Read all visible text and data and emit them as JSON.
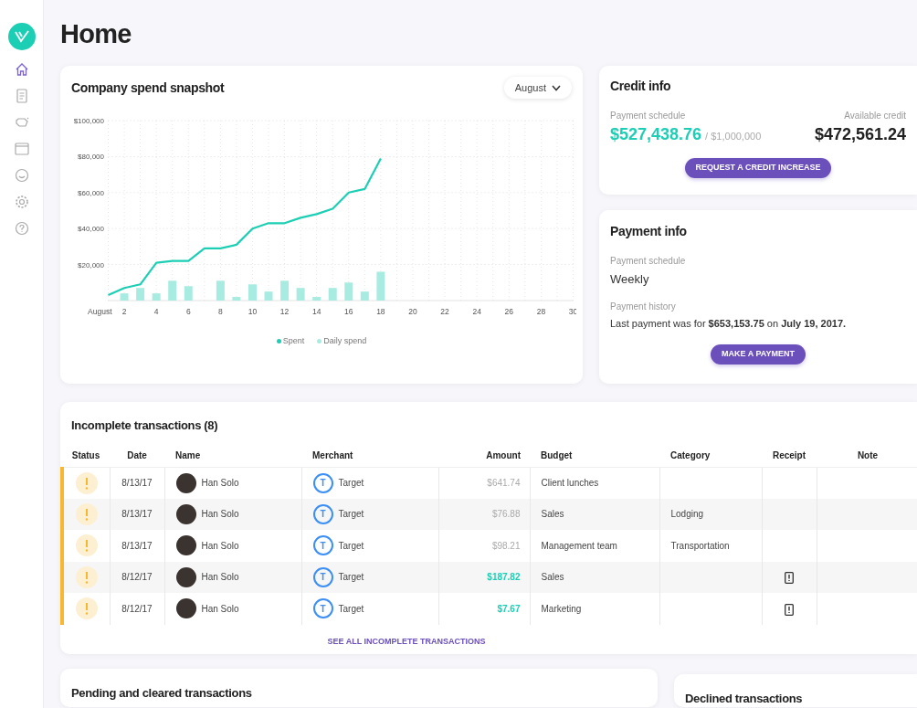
{
  "sidebar": {
    "items": [
      {
        "kind": "home",
        "selected": true
      },
      {
        "kind": "document",
        "selected": false
      },
      {
        "kind": "piggy",
        "selected": false
      },
      {
        "kind": "window",
        "selected": false
      },
      {
        "kind": "smiley",
        "selected": false
      },
      {
        "kind": "gear",
        "selected": false
      },
      {
        "kind": "help",
        "selected": false
      }
    ]
  },
  "page_title": "Home",
  "spend_snapshot": {
    "title": "Company spend snapshot",
    "month_dropdown": "August",
    "chart_data": {
      "type": "line",
      "x": [
        1,
        2,
        3,
        4,
        5,
        6,
        7,
        8,
        9,
        10,
        11,
        12,
        13,
        14,
        15,
        16,
        17,
        18
      ],
      "xlim": [
        1,
        30
      ],
      "ylim": [
        0,
        100000
      ],
      "xlabel": "August",
      "grid": true,
      "xticks": [
        2,
        4,
        6,
        8,
        10,
        12,
        14,
        16,
        18,
        20,
        22,
        24,
        26,
        28,
        30
      ],
      "yticks": [
        {
          "value": 20000,
          "label": "$20,000"
        },
        {
          "value": 40000,
          "label": "$40,000"
        },
        {
          "value": 60000,
          "label": "$60,000"
        },
        {
          "value": 80000,
          "label": "$80,000"
        },
        {
          "value": 100000,
          "label": "$100,000"
        }
      ],
      "series": [
        {
          "name": "Spent",
          "color": "#1ccfb4",
          "values": [
            3000,
            7000,
            9000,
            21000,
            22000,
            22000,
            29000,
            29000,
            31000,
            40000,
            43000,
            43000,
            46000,
            48000,
            51000,
            60000,
            62000,
            79000
          ]
        },
        {
          "name": "Daily spend",
          "type": "bar",
          "color": "#a8ece1",
          "values": [
            null,
            4000,
            7000,
            4000,
            11000,
            8000,
            null,
            11000,
            2000,
            9000,
            5000,
            11000,
            7000,
            2000,
            7000,
            10000,
            5000,
            16000
          ]
        }
      ]
    }
  },
  "credit_info": {
    "title": "Credit info",
    "schedule_label": "Payment schedule",
    "spent": "$527,438.76",
    "limit": "/ $1,000,000",
    "available_label": "Available credit",
    "available": "$472,561.24",
    "button": "REQUEST A CREDIT INCREASE"
  },
  "payment_info": {
    "title": "Payment info",
    "schedule_label": "Payment schedule",
    "schedule": "Weekly",
    "history_label": "Payment history",
    "history": "Last payment was for **$653,153.75** on **July 19, 2017.**",
    "button": "MAKE A PAYMENT"
  },
  "incomplete_transactions": {
    "title": "Incomplete transactions (8)",
    "columns": [
      "Status",
      "Date",
      "Name",
      "Merchant",
      "Amount",
      "Budget",
      "Category",
      "Receipt",
      "Note"
    ],
    "rows": [
      {
        "date": "8/13/17",
        "name": "Han Solo",
        "merchant_initial": "T",
        "merchant": "Target",
        "amount": "$641.74",
        "receipt_attached": false,
        "budget": "Client lunches",
        "category": ""
      },
      {
        "date": "8/13/17",
        "name": "Han Solo",
        "merchant_initial": "T",
        "merchant": "Target",
        "amount": "$76.88",
        "receipt_attached": false,
        "budget": "Sales",
        "category": "Lodging"
      },
      {
        "date": "8/13/17",
        "name": "Han Solo",
        "merchant_initial": "T",
        "merchant": "Target",
        "amount": "$98.21",
        "receipt_attached": false,
        "budget": "Management team",
        "category": "Transportation"
      },
      {
        "date": "8/12/17",
        "name": "Han Solo",
        "merchant_initial": "T",
        "merchant": "Target",
        "amount": "$187.82",
        "receipt_attached": true,
        "budget": "Sales",
        "category": ""
      },
      {
        "date": "8/12/17",
        "name": "Han Solo",
        "merchant_initial": "T",
        "merchant": "Target",
        "amount": "$7.67",
        "receipt_attached": true,
        "budget": "Marketing",
        "category": ""
      }
    ],
    "see_all": "SEE ALL INCOMPLETE TRANSACTIONS"
  },
  "pending_cleared": {
    "title": "Pending and cleared transactions"
  },
  "declined": {
    "title": "Declined transactions"
  }
}
